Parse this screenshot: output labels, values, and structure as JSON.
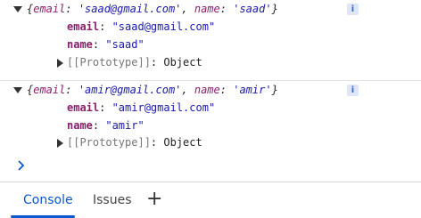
{
  "entries": [
    {
      "summary": {
        "open": "{",
        "k1": "email",
        "sep1": ": ",
        "v1": "'saad@gmail.com'",
        "comma": ", ",
        "k2": "name",
        "sep2": ": ",
        "v2": "'saad'",
        "close": "}"
      },
      "info_icon": "i",
      "props": [
        {
          "key": "email",
          "sep": ": ",
          "value": "\"saad@gmail.com\""
        },
        {
          "key": "name",
          "sep": ": ",
          "value": "\"saad\""
        }
      ],
      "prototype": {
        "key": "[[Prototype]]",
        "sep": ": ",
        "value": "Object"
      }
    },
    {
      "summary": {
        "open": "{",
        "k1": "email",
        "sep1": ": ",
        "v1": "'amir@gmail.com'",
        "comma": ", ",
        "k2": "name",
        "sep2": ": ",
        "v2": "'amir'",
        "close": "}"
      },
      "info_icon": "i",
      "props": [
        {
          "key": "email",
          "sep": ": ",
          "value": "\"amir@gmail.com\""
        },
        {
          "key": "name",
          "sep": ": ",
          "value": "\"amir\""
        }
      ],
      "prototype": {
        "key": "[[Prototype]]",
        "sep": ": ",
        "value": "Object"
      }
    }
  ],
  "tabs": [
    {
      "label": "Console",
      "active": true
    },
    {
      "label": "Issues",
      "active": false
    }
  ],
  "add_tab_label": "+",
  "icons": {
    "expand": "caret-down-icon",
    "collapse": "caret-right-icon",
    "info": "info-icon",
    "prompt": "chevron-right-icon",
    "add": "plus-icon"
  },
  "colors": {
    "key": "#8a1f6c",
    "string": "#1a1aa6",
    "accent": "#0b57d0",
    "info_bg": "#dfe7f6"
  }
}
